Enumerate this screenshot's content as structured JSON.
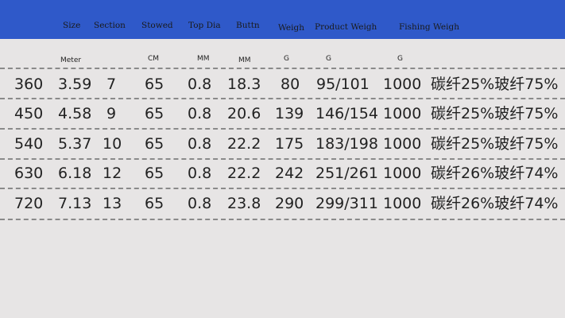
{
  "header": {
    "columns": [
      "Size",
      "Section",
      "Stowed",
      "Top Dia",
      "Buttn",
      "Weigh",
      "Product Weigh",
      "Fishing Weigh"
    ]
  },
  "units": [
    "Meter",
    "CM",
    "MM",
    "MM",
    "G",
    "G",
    "G"
  ],
  "rows": [
    [
      "360",
      "3.59",
      "7",
      "65",
      "0.8",
      "18.3",
      "80",
      "95/101",
      "1000",
      "碳纤25%玻纤75%"
    ],
    [
      "450",
      "4.58",
      "9",
      "65",
      "0.8",
      "20.6",
      "139",
      "146/154",
      "1000",
      "碳纤25%玻纤75%"
    ],
    [
      "540",
      "5.37",
      "10",
      "65",
      "0.8",
      "22.2",
      "175",
      "183/198",
      "1000",
      "碳纤25%玻纤75%"
    ],
    [
      "630",
      "6.18",
      "12",
      "65",
      "0.8",
      "22.2",
      "242",
      "251/261",
      "1000",
      "碳纤26%玻纤74%"
    ],
    [
      "720",
      "7.13",
      "13",
      "65",
      "0.8",
      "23.8",
      "290",
      "299/311",
      "1000",
      "碳纤26%玻纤74%"
    ]
  ],
  "colors": {
    "header_bg": "#2f59c9",
    "page_bg": "#e7e5e5",
    "divider": "#8a8a8a"
  }
}
